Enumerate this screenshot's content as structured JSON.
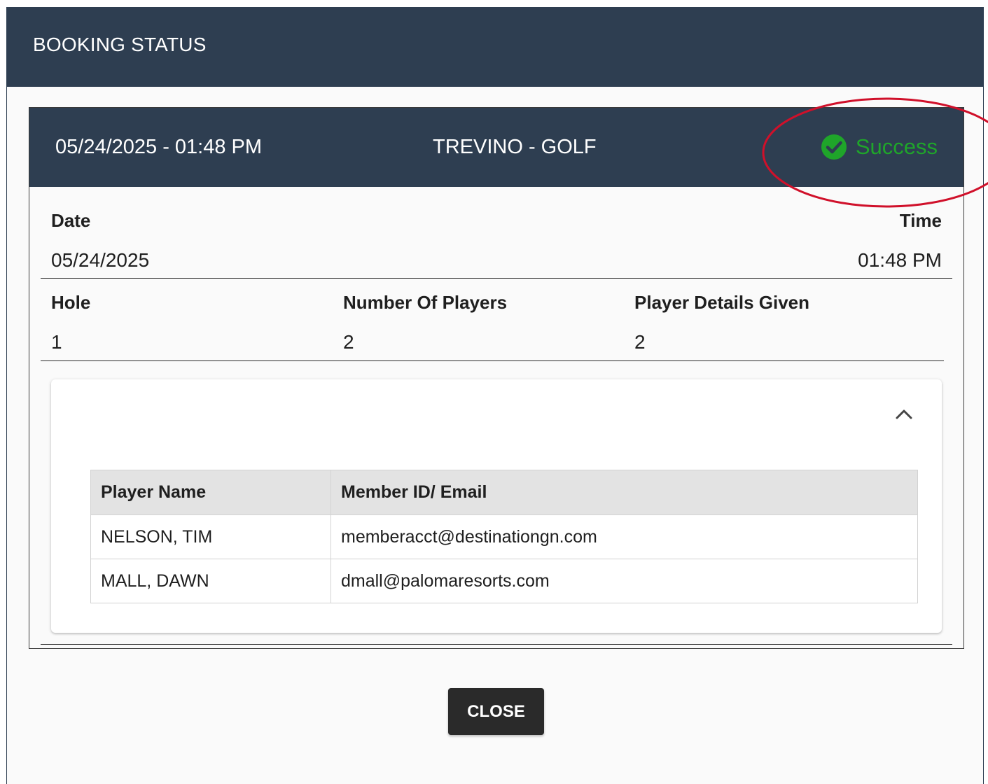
{
  "dialog": {
    "title": "BOOKING STATUS"
  },
  "booking": {
    "datetime": "05/24/2025 - 01:48 PM",
    "course": "TREVINO - GOLF",
    "status": {
      "label": "Success",
      "icon": "check-circle-icon",
      "color": "#1fa52a"
    }
  },
  "details": {
    "date_label": "Date",
    "date_value": "05/24/2025",
    "time_label": "Time",
    "time_value": "01:48 PM",
    "hole_label": "Hole",
    "hole_value": "1",
    "players_label": "Number Of Players",
    "players_value": "2",
    "given_label": "Player Details Given",
    "given_value": "2"
  },
  "players_table": {
    "collapse_icon": "chevron-up-icon",
    "columns": [
      "Player Name",
      "Member ID/ Email"
    ],
    "rows": [
      [
        "NELSON, TIM",
        "memberacct@destinationgn.com"
      ],
      [
        "MALL, DAWN",
        "dmall@palomaresorts.com"
      ]
    ]
  },
  "actions": {
    "close_label": "CLOSE"
  },
  "colors": {
    "header_bg": "#2e3e51",
    "success": "#1fa52a",
    "annotation": "#d0102a"
  }
}
